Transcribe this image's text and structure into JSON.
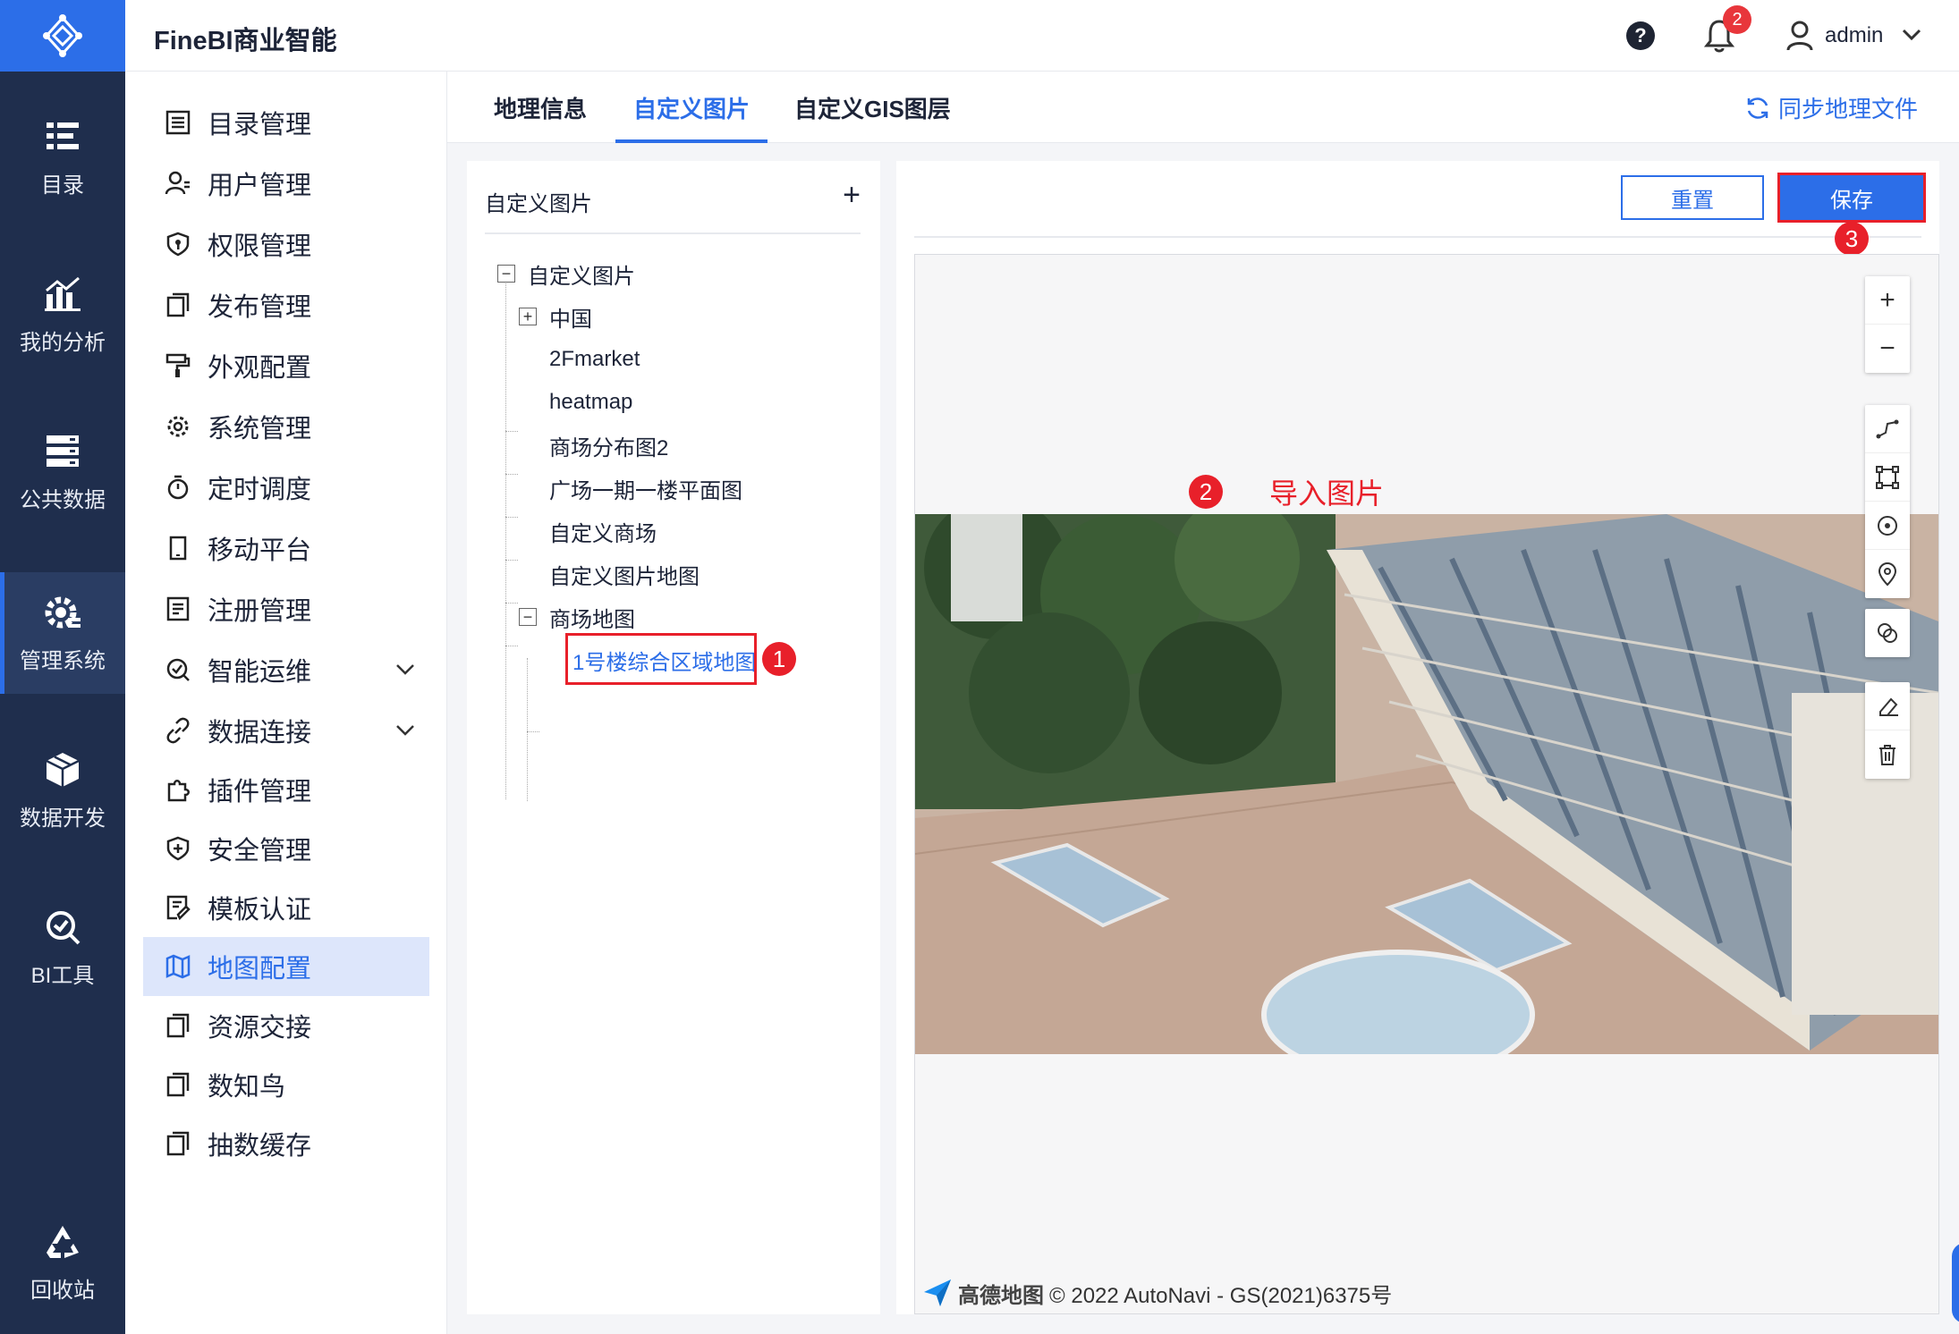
{
  "header": {
    "app_title": "FineBI商业智能",
    "help_glyph": "?",
    "notification_count": "2",
    "username": "admin"
  },
  "rail": {
    "items": [
      {
        "label": "目录",
        "icon": "catalog-icon"
      },
      {
        "label": "我的分析",
        "icon": "analysis-icon"
      },
      {
        "label": "公共数据",
        "icon": "public-data-icon"
      },
      {
        "label": "管理系统",
        "icon": "system-icon",
        "active": true
      },
      {
        "label": "数据开发",
        "icon": "data-dev-icon"
      },
      {
        "label": "BI工具",
        "icon": "bi-tools-icon"
      },
      {
        "label": "回收站",
        "icon": "recycle-icon"
      }
    ]
  },
  "subnav": {
    "items": [
      {
        "label": "目录管理"
      },
      {
        "label": "用户管理"
      },
      {
        "label": "权限管理"
      },
      {
        "label": "发布管理"
      },
      {
        "label": "外观配置"
      },
      {
        "label": "系统管理"
      },
      {
        "label": "定时调度"
      },
      {
        "label": "移动平台"
      },
      {
        "label": "注册管理"
      },
      {
        "label": "智能运维"
      },
      {
        "label": "数据连接"
      },
      {
        "label": "插件管理"
      },
      {
        "label": "安全管理"
      },
      {
        "label": "模板认证"
      },
      {
        "label": "地图配置",
        "active": true
      },
      {
        "label": "资源交接"
      },
      {
        "label": "数知鸟"
      },
      {
        "label": "抽数缓存"
      }
    ]
  },
  "tabs": [
    {
      "label": "地理信息"
    },
    {
      "label": "自定义图片",
      "active": true
    },
    {
      "label": "自定义GIS图层"
    }
  ],
  "sync_label": "同步地理文件",
  "tree": {
    "panel_title": "自定义图片",
    "add_glyph": "+",
    "root": "自定义图片",
    "nodes": [
      {
        "label": "中国",
        "toggle": "+"
      },
      {
        "label": "2Fmarket"
      },
      {
        "label": "heatmap"
      },
      {
        "label": "商场分布图2"
      },
      {
        "label": "广场一期一楼平面图"
      },
      {
        "label": "自定义商场"
      },
      {
        "label": "自定义图片地图"
      },
      {
        "label": "商场地图",
        "toggle": "−"
      },
      {
        "label": "1号楼综合区域地图",
        "selected": true
      }
    ],
    "root_toggle": "−"
  },
  "toolbar": {
    "reset_label": "重置",
    "save_label": "保存"
  },
  "annotations": {
    "step1": "1",
    "step2": "2",
    "step3": "3",
    "import_label": "导入图片"
  },
  "map": {
    "zoom_in": "+",
    "zoom_out": "−",
    "attribution_brand": "高德地图",
    "attribution_text": "© 2022 AutoNavi - GS(2021)6375号"
  },
  "colors": {
    "accent": "#2c6ee8",
    "rail_bg": "#1f2e4d",
    "highlight_red": "#e8202a"
  }
}
